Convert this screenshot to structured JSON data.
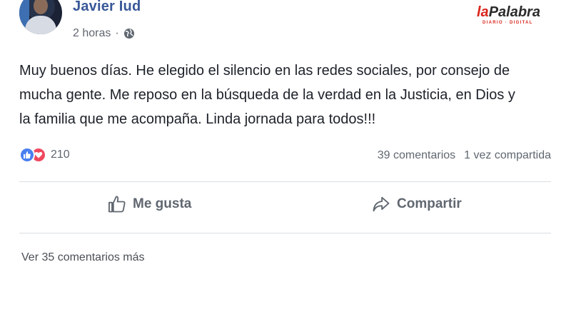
{
  "post": {
    "author": "Javier Iud",
    "time": "2 horas",
    "separator": "·",
    "privacy_icon": "globe-icon",
    "text_lines": [
      "Muy buenos días. He elegido el silencio en las redes sociales, por consejo de",
      "mucha gente. Me reposo en la búsqueda de la verdad en la Justicia, en Dios y",
      "la familia que me acompaña. Linda jornada para todos!!!"
    ]
  },
  "watermark": {
    "brand_part1": "la",
    "brand_part2": "Palabra",
    "subtitle": "DIARIO · DIGITAL"
  },
  "reactions": {
    "icons": [
      "like-icon",
      "love-icon"
    ],
    "count": "210"
  },
  "stats": {
    "comments": "39 comentarios",
    "shares": "1 vez compartida"
  },
  "actions": {
    "like_label": "Me gusta",
    "share_label": "Compartir"
  },
  "comments": {
    "more_label": "Ver 35 comentarios más"
  },
  "colors": {
    "author": "#385898",
    "like": "#4a7ff1",
    "love": "#f0485e",
    "muted": "#606770",
    "brand_red": "#d9261c"
  }
}
